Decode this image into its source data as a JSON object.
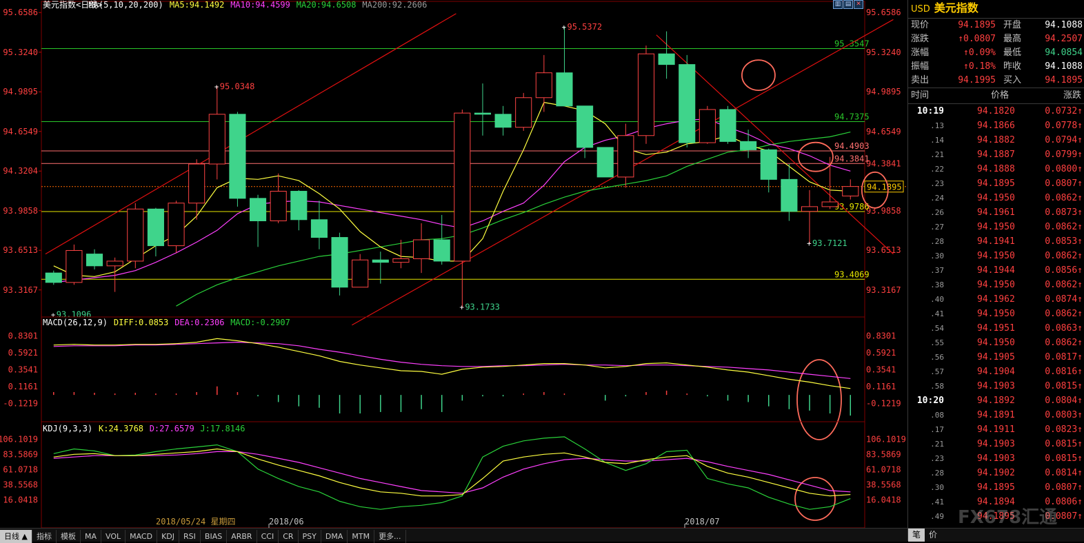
{
  "header": {
    "title": "美元指数<日线>",
    "ma_label": "MA(5,10,20,200)",
    "ma5": "MA5:94.1492",
    "ma10": "MA10:94.4599",
    "ma20": "MA20:94.6508",
    "ma200": "MA200:92.2606"
  },
  "macd_header": {
    "label": "MACD(26,12,9)",
    "diff": "DIFF:0.0853",
    "dea": "DEA:0.2306",
    "macd": "MACD:-0.2907"
  },
  "kdj_header": {
    "label": "KDJ(9,3,3)",
    "k": "K:24.3768",
    "d": "D:27.6579",
    "j": "J:17.8146"
  },
  "colors": {
    "up": "#ff4444",
    "down": "#3fd48b",
    "ma5": "#ffff40",
    "ma10": "#ff40ff",
    "ma20": "#2ad33a",
    "resistance": "#ff4040",
    "grid_green": "#2ac82a",
    "grid_yellow": "#e6e600",
    "annotation": "#ff6b5b"
  },
  "chart_data": {
    "type": "candlestick",
    "ylim": [
      93.1,
      95.66
    ],
    "y_ticks": [
      "95.6586",
      "95.3240",
      "94.9895",
      "94.6549",
      "94.3204",
      "93.9858",
      "93.6513",
      "93.3167"
    ],
    "x_labels": [
      "2018/05/24 星期四",
      "2018/06",
      "2018/07"
    ],
    "candles": [
      {
        "o": 93.46,
        "h": 93.48,
        "l": 93.36,
        "c": 93.38
      },
      {
        "o": 93.38,
        "h": 93.7,
        "l": 93.36,
        "c": 93.65
      },
      {
        "o": 93.62,
        "h": 93.66,
        "l": 93.49,
        "c": 93.52
      },
      {
        "o": 93.52,
        "h": 93.59,
        "l": 93.3,
        "c": 93.56
      },
      {
        "o": 93.56,
        "h": 94.05,
        "l": 93.5,
        "c": 94.0
      },
      {
        "o": 94.0,
        "h": 94.01,
        "l": 93.6,
        "c": 93.69
      },
      {
        "o": 93.69,
        "h": 94.07,
        "l": 93.63,
        "c": 94.05
      },
      {
        "o": 94.05,
        "h": 94.42,
        "l": 93.91,
        "c": 94.38
      },
      {
        "o": 94.38,
        "h": 95.04,
        "l": 94.25,
        "c": 94.8
      },
      {
        "o": 94.8,
        "h": 94.82,
        "l": 94.02,
        "c": 94.09
      },
      {
        "o": 94.09,
        "h": 94.12,
        "l": 93.68,
        "c": 93.9
      },
      {
        "o": 93.9,
        "h": 94.3,
        "l": 93.88,
        "c": 94.15
      },
      {
        "o": 94.15,
        "h": 94.16,
        "l": 93.82,
        "c": 93.91
      },
      {
        "o": 93.91,
        "h": 94.07,
        "l": 93.66,
        "c": 93.76
      },
      {
        "o": 93.76,
        "h": 93.8,
        "l": 93.27,
        "c": 93.34
      },
      {
        "o": 93.34,
        "h": 93.62,
        "l": 93.4,
        "c": 93.57
      },
      {
        "o": 93.57,
        "h": 93.64,
        "l": 93.37,
        "c": 93.55
      },
      {
        "o": 93.55,
        "h": 93.74,
        "l": 93.5,
        "c": 93.58
      },
      {
        "o": 93.58,
        "h": 93.88,
        "l": 93.46,
        "c": 93.74
      },
      {
        "o": 93.74,
        "h": 93.95,
        "l": 93.53,
        "c": 93.56
      },
      {
        "o": 93.56,
        "h": 94.84,
        "l": 93.17,
        "c": 94.81
      },
      {
        "o": 94.81,
        "h": 95.06,
        "l": 94.62,
        "c": 94.8
      },
      {
        "o": 94.8,
        "h": 94.87,
        "l": 94.62,
        "c": 94.69
      },
      {
        "o": 94.69,
        "h": 94.98,
        "l": 94.66,
        "c": 94.94
      },
      {
        "o": 94.94,
        "h": 95.3,
        "l": 94.82,
        "c": 95.15
      },
      {
        "o": 95.15,
        "h": 95.54,
        "l": 94.89,
        "c": 94.87
      },
      {
        "o": 94.87,
        "h": 94.87,
        "l": 94.43,
        "c": 94.52
      },
      {
        "o": 94.52,
        "h": 94.52,
        "l": 94.28,
        "c": 94.27
      },
      {
        "o": 94.27,
        "h": 94.72,
        "l": 94.18,
        "c": 94.62
      },
      {
        "o": 94.62,
        "h": 95.38,
        "l": 94.55,
        "c": 95.31
      },
      {
        "o": 95.31,
        "h": 95.5,
        "l": 95.1,
        "c": 95.22
      },
      {
        "o": 95.22,
        "h": 95.3,
        "l": 94.52,
        "c": 94.56
      },
      {
        "o": 94.56,
        "h": 94.87,
        "l": 94.55,
        "c": 94.84
      },
      {
        "o": 94.84,
        "h": 94.87,
        "l": 94.55,
        "c": 94.57
      },
      {
        "o": 94.57,
        "h": 94.67,
        "l": 94.43,
        "c": 94.5
      },
      {
        "o": 94.5,
        "h": 94.51,
        "l": 94.14,
        "c": 94.25
      },
      {
        "o": 94.25,
        "h": 94.38,
        "l": 93.9,
        "c": 93.98
      },
      {
        "o": 93.98,
        "h": 94.16,
        "l": 93.71,
        "c": 94.02
      },
      {
        "o": 94.02,
        "h": 94.44,
        "l": 94.0,
        "c": 94.06
      },
      {
        "o": 94.11,
        "h": 94.25,
        "l": 94.08,
        "c": 94.19
      }
    ],
    "ma5": [
      93.52,
      93.44,
      93.43,
      93.47,
      93.58,
      93.69,
      93.78,
      93.94,
      94.18,
      94.26,
      94.25,
      94.28,
      94.24,
      94.13,
      94.0,
      93.81,
      93.68,
      93.6,
      93.59,
      93.56,
      93.56,
      93.75,
      94.15,
      94.5,
      94.9,
      94.87,
      94.83,
      94.72,
      94.51,
      94.46,
      94.48,
      94.55,
      94.57,
      94.62,
      94.54,
      94.49,
      94.36,
      94.23,
      94.16,
      94.15
    ],
    "ma10": [
      93.38,
      93.4,
      93.42,
      93.44,
      93.48,
      93.55,
      93.63,
      93.72,
      93.82,
      93.96,
      94.04,
      94.06,
      94.07,
      94.06,
      94.03,
      94.0,
      93.97,
      93.94,
      93.91,
      93.87,
      93.84,
      93.9,
      93.98,
      94.05,
      94.2,
      94.4,
      94.52,
      94.58,
      94.62,
      94.68,
      94.72,
      94.75,
      94.76,
      94.69,
      94.63,
      94.55,
      94.51,
      94.45,
      94.37,
      94.32
    ],
    "ma20": [
      null,
      null,
      null,
      null,
      null,
      null,
      93.18,
      93.28,
      93.36,
      93.42,
      93.47,
      93.52,
      93.56,
      93.6,
      93.62,
      93.65,
      93.68,
      93.71,
      93.74,
      93.75,
      93.78,
      93.84,
      93.91,
      93.97,
      94.04,
      94.1,
      94.15,
      94.18,
      94.21,
      94.24,
      94.28,
      94.36,
      94.42,
      94.48,
      94.5,
      94.54,
      94.57,
      94.59,
      94.61,
      94.65
    ],
    "hlines": [
      {
        "value": 95.3547,
        "label": "95.3547",
        "color": "#2ac82a"
      },
      {
        "value": 94.7375,
        "label": "94.7375",
        "color": "#2ac82a"
      },
      {
        "value": 94.4903,
        "label": "94.4903",
        "color": "#ff7070"
      },
      {
        "value": 94.3841,
        "label": "94.3841",
        "color": "#ff7070"
      },
      {
        "value": 93.9786,
        "label": "93.9786",
        "color": "#e6e600"
      },
      {
        "value": 93.4069,
        "label": "93.4069",
        "color": "#e6e600"
      }
    ],
    "annotations": [
      {
        "label": "95.0348",
        "i": 8,
        "v": 95.0348,
        "pos": "above"
      },
      {
        "label": "95.5372",
        "i": 25,
        "v": 95.5372,
        "pos": "above"
      },
      {
        "label": "93.1096",
        "i": 0,
        "v": 93.1096,
        "pos": "below"
      },
      {
        "label": "93.1733",
        "i": 20,
        "v": 93.1733,
        "pos": "below"
      },
      {
        "label": "93.7121",
        "i": 37,
        "v": 93.7121,
        "pos": "below"
      }
    ],
    "last_price": "94.1895",
    "left_ticks": [
      "95.6586",
      "95.3240",
      "94.9895",
      "94.6549",
      "94.3204",
      "93.9858",
      "93.6513",
      "93.3167"
    ],
    "right_ticks": [
      "95.6586",
      "95.3240",
      "94.9895",
      "94.6549",
      "94.3841",
      "93.9858",
      "93.6513",
      "93.3167"
    ],
    "macd": {
      "ticks": [
        "0.8301",
        "0.5921",
        "0.3541",
        "0.1161",
        "-0.1219"
      ],
      "ylim": [
        -0.26,
        0.92
      ],
      "diff": [
        0.7,
        0.71,
        0.7,
        0.7,
        0.71,
        0.71,
        0.72,
        0.74,
        0.79,
        0.76,
        0.72,
        0.67,
        0.61,
        0.55,
        0.47,
        0.42,
        0.38,
        0.34,
        0.33,
        0.29,
        0.36,
        0.39,
        0.4,
        0.42,
        0.44,
        0.44,
        0.42,
        0.38,
        0.4,
        0.44,
        0.45,
        0.42,
        0.39,
        0.35,
        0.32,
        0.27,
        0.22,
        0.18,
        0.13,
        0.09
      ],
      "dea": [
        0.68,
        0.69,
        0.69,
        0.69,
        0.7,
        0.7,
        0.71,
        0.72,
        0.73,
        0.74,
        0.73,
        0.72,
        0.69,
        0.64,
        0.6,
        0.55,
        0.5,
        0.46,
        0.43,
        0.41,
        0.4,
        0.4,
        0.41,
        0.41,
        0.42,
        0.43,
        0.42,
        0.42,
        0.41,
        0.42,
        0.42,
        0.41,
        0.4,
        0.39,
        0.37,
        0.35,
        0.32,
        0.29,
        0.26,
        0.23
      ],
      "hist": [
        0.04,
        0.04,
        0.03,
        0.02,
        0.03,
        0.02,
        0.02,
        0.04,
        0.12,
        0.04,
        -0.02,
        -0.1,
        -0.16,
        -0.18,
        -0.26,
        -0.26,
        -0.24,
        -0.24,
        -0.2,
        -0.24,
        -0.08,
        -0.02,
        -0.02,
        0.02,
        0.04,
        0.02,
        0.0,
        -0.08,
        -0.02,
        0.04,
        0.06,
        0.02,
        -0.02,
        -0.08,
        -0.1,
        -0.16,
        -0.2,
        -0.22,
        -0.26,
        -0.29
      ]
    },
    "kdj": {
      "ticks": [
        "106.1019",
        "83.5869",
        "61.0718",
        "38.5568",
        "16.0418"
      ],
      "ylim": [
        -5,
        112
      ],
      "k": [
        80,
        84,
        85,
        82,
        82,
        84,
        86,
        88,
        92,
        88,
        77,
        68,
        60,
        52,
        42,
        34,
        28,
        26,
        22,
        22,
        24,
        48,
        74,
        80,
        84,
        86,
        80,
        72,
        70,
        76,
        80,
        82,
        66,
        56,
        50,
        42,
        34,
        26,
        22,
        24
      ],
      "d": [
        78,
        80,
        82,
        82,
        82,
        82,
        83,
        85,
        88,
        88,
        84,
        78,
        72,
        64,
        56,
        48,
        42,
        36,
        30,
        28,
        26,
        34,
        50,
        62,
        70,
        76,
        78,
        76,
        74,
        74,
        76,
        78,
        73,
        66,
        60,
        54,
        46,
        38,
        30,
        28
      ],
      "j": [
        85,
        92,
        89,
        82,
        83,
        88,
        92,
        95,
        98,
        88,
        62,
        48,
        36,
        28,
        14,
        6,
        2,
        6,
        8,
        12,
        22,
        80,
        96,
        104,
        108,
        110,
        92,
        72,
        60,
        70,
        88,
        90,
        48,
        40,
        34,
        20,
        10,
        2,
        6,
        18
      ]
    }
  },
  "bottom_tabs": [
    "日线 ▲",
    "指标",
    "模板",
    "MA",
    "VOL",
    "MACD",
    "KDJ",
    "RSI",
    "BIAS",
    "ARBR",
    "CCI",
    "CR",
    "PSY",
    "DMA",
    "MTM",
    "更多..."
  ],
  "side": {
    "title_code": "USD",
    "title_name": "美元指数",
    "quotes": [
      {
        "l1": "现价",
        "v1": "94.1895",
        "c1": "#ff4040",
        "l2": "开盘",
        "v2": "94.1088",
        "c2": "#ffffff"
      },
      {
        "l1": "涨跌",
        "v1": "↑0.0807",
        "c1": "#ff4040",
        "l2": "最高",
        "v2": "94.2507",
        "c2": "#ff4040"
      },
      {
        "l1": "涨幅",
        "v1": "↑0.09%",
        "c1": "#ff4040",
        "l2": "最低",
        "v2": "94.0854",
        "c2": "#3fd48b"
      },
      {
        "l1": "振幅",
        "v1": "↑0.18%",
        "c1": "#ff4040",
        "l2": "昨收",
        "v2": "94.1088",
        "c2": "#ffffff"
      },
      {
        "l1": "卖出",
        "v1": "94.1995",
        "c1": "#ff4040",
        "l2": "买入",
        "v2": "94.1895",
        "c2": "#ff4040"
      }
    ],
    "tick_header": {
      "time": "时间",
      "price": "价格",
      "change": "涨跌"
    },
    "ticks": [
      {
        "t": "10:19",
        "p": "94.1820",
        "c": "0.0732↑",
        "major": true
      },
      {
        "t": ".13",
        "p": "94.1866",
        "c": "0.0778↑",
        "major": false
      },
      {
        "t": ".14",
        "p": "94.1882",
        "c": "0.0794↑",
        "major": false
      },
      {
        "t": ".21",
        "p": "94.1887",
        "c": "0.0799↑",
        "major": false
      },
      {
        "t": ".22",
        "p": "94.1888",
        "c": "0.0800↑",
        "major": false
      },
      {
        "t": ".23",
        "p": "94.1895",
        "c": "0.0807↑",
        "major": false
      },
      {
        "t": ".24",
        "p": "94.1950",
        "c": "0.0862↑",
        "major": false
      },
      {
        "t": ".26",
        "p": "94.1961",
        "c": "0.0873↑",
        "major": false
      },
      {
        "t": ".27",
        "p": "94.1950",
        "c": "0.0862↑",
        "major": false
      },
      {
        "t": ".28",
        "p": "94.1941",
        "c": "0.0853↑",
        "major": false
      },
      {
        "t": ".30",
        "p": "94.1950",
        "c": "0.0862↑",
        "major": false
      },
      {
        "t": ".37",
        "p": "94.1944",
        "c": "0.0856↑",
        "major": false
      },
      {
        "t": ".38",
        "p": "94.1950",
        "c": "0.0862↑",
        "major": false
      },
      {
        "t": ".40",
        "p": "94.1962",
        "c": "0.0874↑",
        "major": false
      },
      {
        "t": ".41",
        "p": "94.1950",
        "c": "0.0862↑",
        "major": false
      },
      {
        "t": ".54",
        "p": "94.1951",
        "c": "0.0863↑",
        "major": false
      },
      {
        "t": ".55",
        "p": "94.1950",
        "c": "0.0862↑",
        "major": false
      },
      {
        "t": ".56",
        "p": "94.1905",
        "c": "0.0817↑",
        "major": false
      },
      {
        "t": ".57",
        "p": "94.1904",
        "c": "0.0816↑",
        "major": false
      },
      {
        "t": ".58",
        "p": "94.1903",
        "c": "0.0815↑",
        "major": false
      },
      {
        "t": "10:20",
        "p": "94.1892",
        "c": "0.0804↑",
        "major": true
      },
      {
        "t": ".08",
        "p": "94.1891",
        "c": "0.0803↑",
        "major": false
      },
      {
        "t": ".17",
        "p": "94.1911",
        "c": "0.0823↑",
        "major": false
      },
      {
        "t": ".21",
        "p": "94.1903",
        "c": "0.0815↑",
        "major": false
      },
      {
        "t": ".23",
        "p": "94.1903",
        "c": "0.0815↑",
        "major": false
      },
      {
        "t": ".28",
        "p": "94.1902",
        "c": "0.0814↑",
        "major": false
      },
      {
        "t": ".30",
        "p": "94.1895",
        "c": "0.0807↑",
        "major": false
      },
      {
        "t": ".41",
        "p": "94.1894",
        "c": "0.0806↑",
        "major": false
      },
      {
        "t": ".49",
        "p": "94.1895",
        "c": "0.0807↑",
        "major": false
      }
    ],
    "bottom_tabs": [
      "笔",
      "价"
    ],
    "watermark": "FX678汇通"
  }
}
